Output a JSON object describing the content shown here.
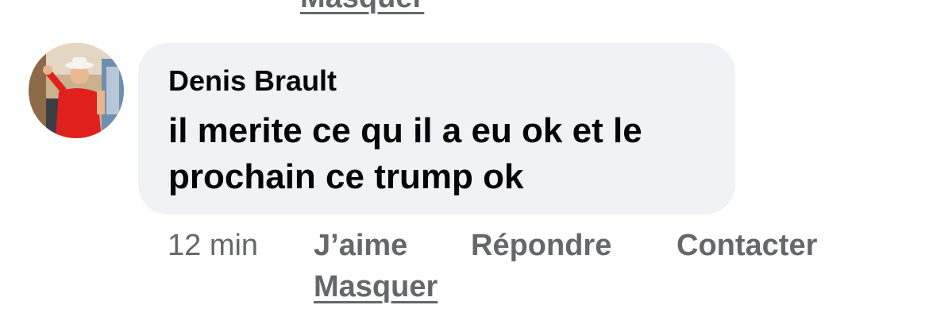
{
  "previous_comment": {
    "hide_label": "Masquer"
  },
  "comment": {
    "author": "Denis Brault",
    "avatar_icon": "profile-photo",
    "text": "il merite ce qu il a eu ok et le prochain ce trump ok",
    "timestamp": "12 min",
    "actions": {
      "like": "J’aime",
      "reply": "Répondre",
      "contact": "Contacter",
      "hide": "Masquer"
    }
  },
  "colors": {
    "bubble_background": "#f0f2f5",
    "text_primary": "#050505",
    "text_secondary": "#65676b"
  }
}
